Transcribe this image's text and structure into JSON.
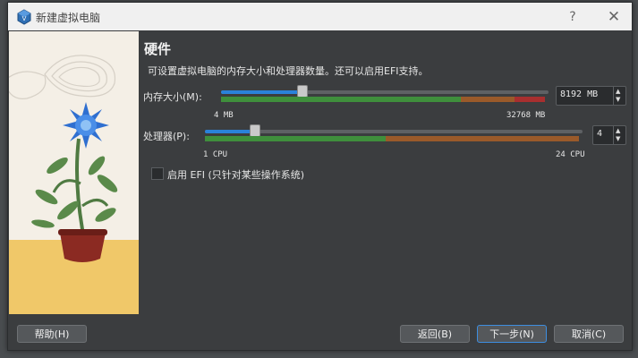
{
  "window": {
    "title": "新建虚拟电脑"
  },
  "titlebar": {
    "help_glyph": "?",
    "close_glyph": "✕"
  },
  "page": {
    "heading": "硬件",
    "description": "可设置虚拟电脑的内存大小和处理器数量。还可以启用EFI支持。"
  },
  "memory": {
    "label": "内存大小(M):",
    "value": 8192,
    "value_text": "8192 MB",
    "min_label": "4 MB",
    "max_label": "32768 MB",
    "min": 4,
    "max": 32768
  },
  "cpu": {
    "label": "处理器(P):",
    "value": 4,
    "value_text": "4",
    "min_label": "1 CPU",
    "max_label": "24 CPU",
    "min": 1,
    "max": 24
  },
  "efi": {
    "label": "启用 EFI (只针对某些操作系统)",
    "checked": false
  },
  "buttons": {
    "help": "帮助(H)",
    "back": "返回(B)",
    "next": "下一步(N)",
    "cancel": "取消(C)"
  },
  "colors": {
    "accent": "#2a82da",
    "band_green": "#3f8f3c",
    "band_orange": "#9a5a2a",
    "band_red": "#a82f2f"
  }
}
